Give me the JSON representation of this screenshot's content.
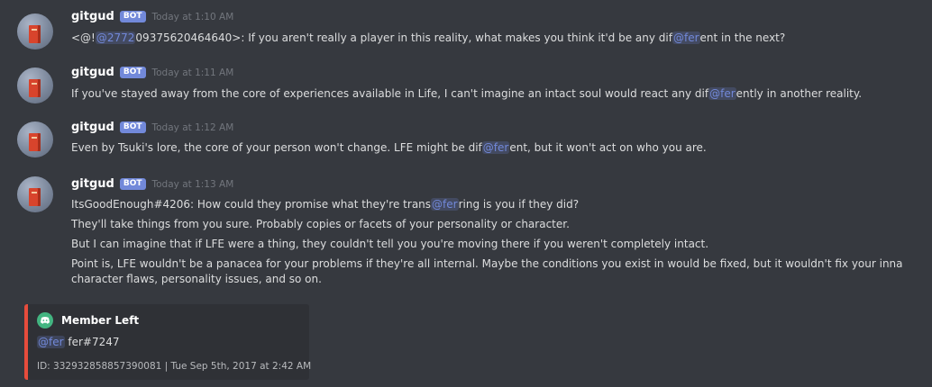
{
  "messages": [
    {
      "username": "gitgud",
      "bot_tag": "BOT",
      "timestamp": "Today at 1:10 AM",
      "lines": [
        {
          "segments": [
            {
              "text": "<@!",
              "mention": false
            },
            {
              "text": "@2772",
              "mention": true
            },
            {
              "text": "09375620464640>: If you aren't really a player in this reality, what makes you think it'd be any dif",
              "mention": false
            },
            {
              "text": "@fer",
              "mention": true
            },
            {
              "text": "ent in the next?",
              "mention": false
            }
          ]
        }
      ]
    },
    {
      "username": "gitgud",
      "bot_tag": "BOT",
      "timestamp": "Today at 1:11 AM",
      "lines": [
        {
          "segments": [
            {
              "text": "If you've stayed away from the core of experiences available in Life, I can't imagine an intact soul would react any dif",
              "mention": false
            },
            {
              "text": "@fer",
              "mention": true
            },
            {
              "text": "ently in another reality.",
              "mention": false
            }
          ]
        }
      ]
    },
    {
      "username": "gitgud",
      "bot_tag": "BOT",
      "timestamp": "Today at 1:12 AM",
      "lines": [
        {
          "segments": [
            {
              "text": "Even by Tsuki's lore, the core of your person won't change. LFE might be dif",
              "mention": false
            },
            {
              "text": "@fer",
              "mention": true
            },
            {
              "text": "ent, but it won't act on who you are.",
              "mention": false
            }
          ]
        }
      ]
    },
    {
      "username": "gitgud",
      "bot_tag": "BOT",
      "timestamp": "Today at 1:13 AM",
      "lines": [
        {
          "segments": [
            {
              "text": "ItsGoodEnough#4206: How could they promise what they're trans",
              "mention": false
            },
            {
              "text": "@fer",
              "mention": true
            },
            {
              "text": "ring is you if they did?",
              "mention": false
            }
          ]
        },
        {
          "segments": [
            {
              "text": "They'll take things from you sure. Probably copies or facets of your personality or character.",
              "mention": false
            }
          ]
        },
        {
          "segments": [
            {
              "text": "But I can imagine that if LFE were a thing, they couldn't tell you you're moving there if you weren't completely intact.",
              "mention": false
            }
          ]
        },
        {
          "segments": [
            {
              "text": "Point is, LFE wouldn't be a panacea for your problems if they're all internal. Maybe the conditions you exist in would be fixed, but it wouldn't fix your inna",
              "mention": false
            }
          ]
        },
        {
          "segments": [
            {
              "text": "character flaws, personality issues, and so on.",
              "mention": false
            }
          ]
        }
      ]
    }
  ],
  "embed": {
    "author_icon": "discord-logo-icon",
    "author": "Member Left",
    "mention": "@fer",
    "description_rest": " fer#7247",
    "footer": "ID: 332932858857390081 | Tue Sep 5th, 2017 at 2:42 AM",
    "accent_color": "#e74c3c"
  },
  "colors": {
    "background": "#36393f",
    "username": "#ffffff",
    "text": "#dcddde",
    "timestamp": "#72767d",
    "mention": "#7289da",
    "bot_tag": "#7289da",
    "embed_background": "#2f3136",
    "discord_icon": "#43b581"
  }
}
